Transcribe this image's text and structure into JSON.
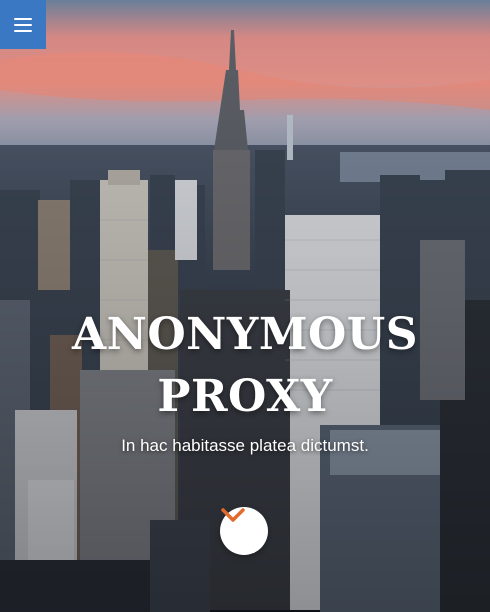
{
  "nav": {
    "menu_icon": "hamburger-menu-icon",
    "accent_color": "#3a78c3"
  },
  "hero": {
    "title_line1": "ANONYMOUS",
    "title_line2": "PROXY",
    "subtitle": "In hac habitasse platea dictumst.",
    "scroll_icon": "chevron-down-icon",
    "scroll_icon_color": "#e26a2c"
  }
}
